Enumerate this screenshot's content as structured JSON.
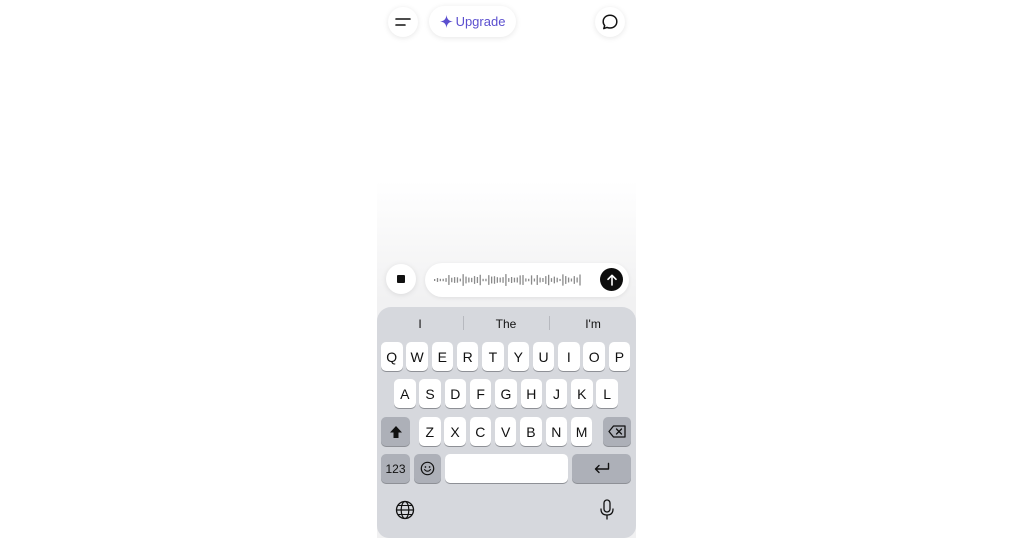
{
  "header": {
    "upgrade_label": "Upgrade",
    "menu_icon": "menu-icon",
    "new_chat_icon": "new-chat-icon"
  },
  "composer": {
    "stop_icon": "stop-icon",
    "waveform_icon": "waveform-icon",
    "send_icon": "arrow-up-icon"
  },
  "keyboard": {
    "suggestions": [
      "I",
      "The",
      "I'm"
    ],
    "row1": [
      "Q",
      "W",
      "E",
      "R",
      "T",
      "Y",
      "U",
      "I",
      "O",
      "P"
    ],
    "row2": [
      "A",
      "S",
      "D",
      "F",
      "G",
      "H",
      "J",
      "K",
      "L"
    ],
    "row3": [
      "Z",
      "X",
      "C",
      "V",
      "B",
      "N",
      "M"
    ],
    "numbers_label": "123",
    "emoji_icon": "emoji-icon",
    "shift_icon": "shift-icon",
    "backspace_icon": "backspace-icon",
    "return_icon": "return-icon",
    "globe_icon": "globe-icon",
    "mic_icon": "microphone-icon"
  },
  "colors": {
    "accent": "#5b4fcf",
    "send_bg": "#0d0d0d",
    "keyboard_bg": "#d6d8dd"
  }
}
